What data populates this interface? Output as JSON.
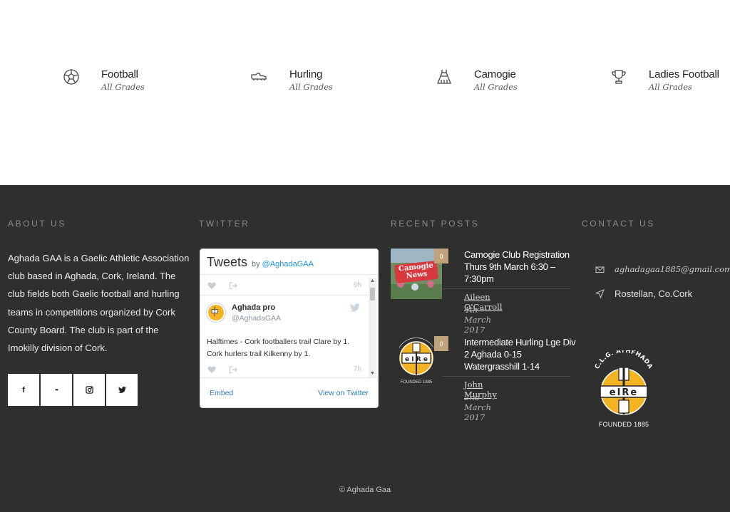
{
  "sports": [
    {
      "name": "Football",
      "sub": "All Grades",
      "icon": "football-icon"
    },
    {
      "name": "Hurling",
      "sub": "All Grades",
      "icon": "hurling-boot-icon"
    },
    {
      "name": "Camogie",
      "sub": "All Grades",
      "icon": "camogie-dress-icon"
    },
    {
      "name": "Ladies Football",
      "sub": "All Grades",
      "icon": "trophy-icon"
    }
  ],
  "footer": {
    "about": {
      "title": "About Us",
      "text": "Aghada GAA is a Gaelic Athletic Association club based in Aghada, Cork, Ireland. The club fields both Gaelic football and hurling teams in competitions organized by Cork County Board. The club is part of the Imokilly division of Cork.",
      "social": [
        {
          "label": "f",
          "icon": "facebook-icon"
        },
        {
          "label": "••",
          "icon": "flickr-icon"
        },
        {
          "label": "",
          "icon": "instagram-icon"
        },
        {
          "label": "",
          "icon": "twitter-icon"
        }
      ]
    },
    "twitter": {
      "title": "Twitter",
      "widget": {
        "heading": "Tweets",
        "by": "by",
        "handle": "@AghadaGAA",
        "top_time": "6h",
        "tweet": {
          "name": "Aghada pro",
          "handle": "@AghadaGAA",
          "text": "Halftimes - Cork footballers trail Clare by 1. Cork hurlers trail Kilkenny by 1.",
          "time": "7h"
        },
        "embed": "Embed",
        "view": "View on Twitter"
      }
    },
    "recent": {
      "title": "Recent Posts",
      "posts": [
        {
          "title": "Camogie Club Registration Thurs 9th March 6:30 – 7:30pm",
          "author": "Aileen O'Carroll",
          "date": "4th March 2017",
          "comments": "0",
          "thumb_text": "Camogie News"
        },
        {
          "title": "Intermediate Hurling Lge Div 2 Aghada 0-15 Watergrasshill 1-14",
          "author": "John Murphy",
          "date": "2nd March 2017",
          "comments": "0",
          "thumb_text": "FOUNDED 1885"
        }
      ]
    },
    "contact": {
      "title": "Contact Us",
      "email": "aghadagaa1885@gmail.com",
      "address": "Rostellan, Co.Cork",
      "crest_caption": "FOUNDED 1885"
    },
    "copyright": "© Aghada Gaa"
  },
  "colors": {
    "footer_bg": "#2f2f2f",
    "badge": "#c0a37a",
    "crest_yellow": "#f3b323",
    "link_blue": "#2b7bb9"
  }
}
